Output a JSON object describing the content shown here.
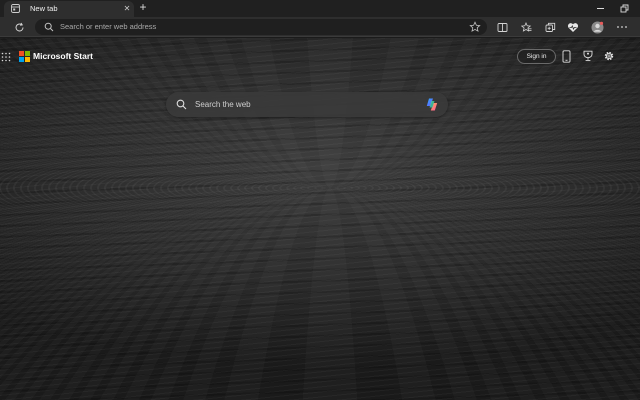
{
  "tab": {
    "title": "New tab",
    "close": "✕"
  },
  "new_tab": {
    "label": "+"
  },
  "addressbar": {
    "placeholder": "Search or enter web address"
  },
  "header": {
    "brand": "Microsoft Start",
    "signin_label": "Sign in"
  },
  "search": {
    "placeholder": "Search the web"
  },
  "colors": {
    "ms_red": "#f25022",
    "ms_green": "#7fba00",
    "ms_blue": "#00a4ef",
    "ms_yellow": "#ffb900",
    "tab_active": "#2e2e2e",
    "toolbar": "#2e2e2e",
    "searchbox": "#3a3a3a"
  },
  "icons": [
    "tab-favicon-icon",
    "close-icon",
    "plus-icon",
    "minimize-icon",
    "restore-icon",
    "refresh-icon",
    "search-icon",
    "star-icon",
    "split-screen-icon",
    "favorites-icon",
    "collections-icon",
    "heart-pulse-icon",
    "profile-avatar-icon",
    "more-icon",
    "app-launcher-icon",
    "microsoft-logo-icon",
    "phone-icon",
    "rewards-trophy-icon",
    "settings-gear-icon",
    "copilot-icon"
  ]
}
